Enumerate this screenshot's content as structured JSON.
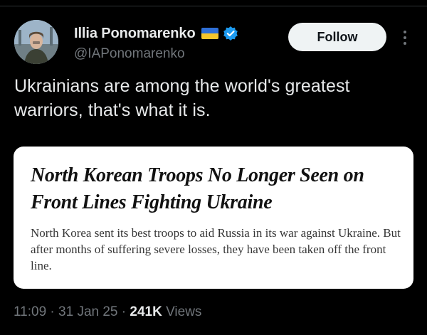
{
  "author": {
    "display_name": "Illia Ponomarenko",
    "handle": "@IAPonomarenko",
    "flag_icon": "ukraine-flag-icon",
    "verified_icon": "verified-badge-icon",
    "verified_color": "#1d9bf0"
  },
  "follow_button": {
    "label": "Follow"
  },
  "more_button": {
    "icon": "more-vertical-icon"
  },
  "tweet": {
    "text": "Ukrainians are among the world's greatest warriors, that's what it is."
  },
  "article_card": {
    "headline": "North Korean Troops No Longer Seen on Front Lines Fighting Ukraine",
    "summary": "North Korea sent its best troops to aid Russia in its war against Ukraine. But after months of suffering severe losses, they have been taken off the front line."
  },
  "meta": {
    "time": "11:09",
    "date": "31 Jan 25",
    "separator": "·",
    "views_count": "241K",
    "views_label": "Views"
  },
  "colors": {
    "background": "#000000",
    "primary_text": "#e7e9ea",
    "secondary_text": "#71767b",
    "follow_bg": "#eff3f4",
    "card_bg": "#ffffff"
  }
}
